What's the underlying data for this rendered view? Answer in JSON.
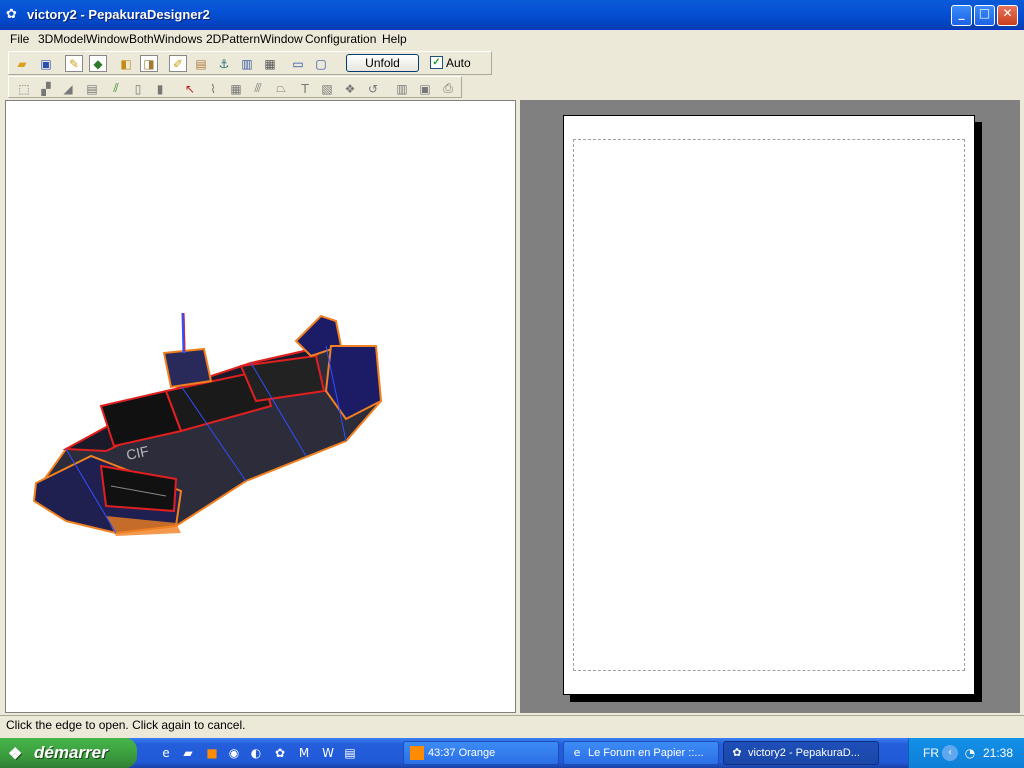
{
  "window": {
    "title": "victory2 - PepakuraDesigner2",
    "app_icon": "pepakura-icon"
  },
  "menu": [
    "File",
    "3DModelWindow",
    "BothWindows",
    "2DPatternWindow",
    "Configuration",
    "Help"
  ],
  "toolbar": {
    "unfold_label": "Unfold",
    "auto_label": "Auto",
    "auto_checked": true
  },
  "status": {
    "text": "Click the edge to open. Click again to cancel."
  },
  "taskbar": {
    "start_label": "démarrer",
    "tasks": [
      {
        "label": "43:37 Orange",
        "icon": "orange-icon"
      },
      {
        "label": "Le Forum en Papier ::...",
        "icon": "ie-icon"
      },
      {
        "label": "victory2 - PepakuraD...",
        "icon": "pepakura-icon"
      }
    ],
    "tray_lang": "FR",
    "clock": "21:38"
  },
  "colors": {
    "title_blue": "#0551d4",
    "start_green": "#3b9c3e",
    "pattern_bg": "#808080"
  }
}
